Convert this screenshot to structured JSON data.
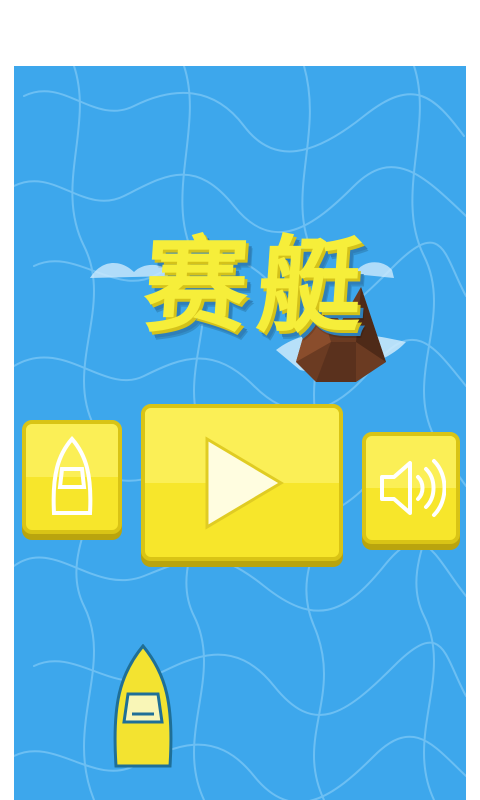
{
  "game": {
    "title": "赛艇"
  },
  "buttons": {
    "boat": {
      "icon": "boat-icon"
    },
    "play": {
      "icon": "play-icon"
    },
    "sound": {
      "icon": "speaker-icon"
    }
  },
  "colors": {
    "water": "#3da7ec",
    "water_lines": "#7cc8f6",
    "title": "#f6ee3a",
    "button": "#f7e62b",
    "button_border": "#d9c415",
    "rock": "#6b3b22",
    "boat": "#f3e330"
  }
}
